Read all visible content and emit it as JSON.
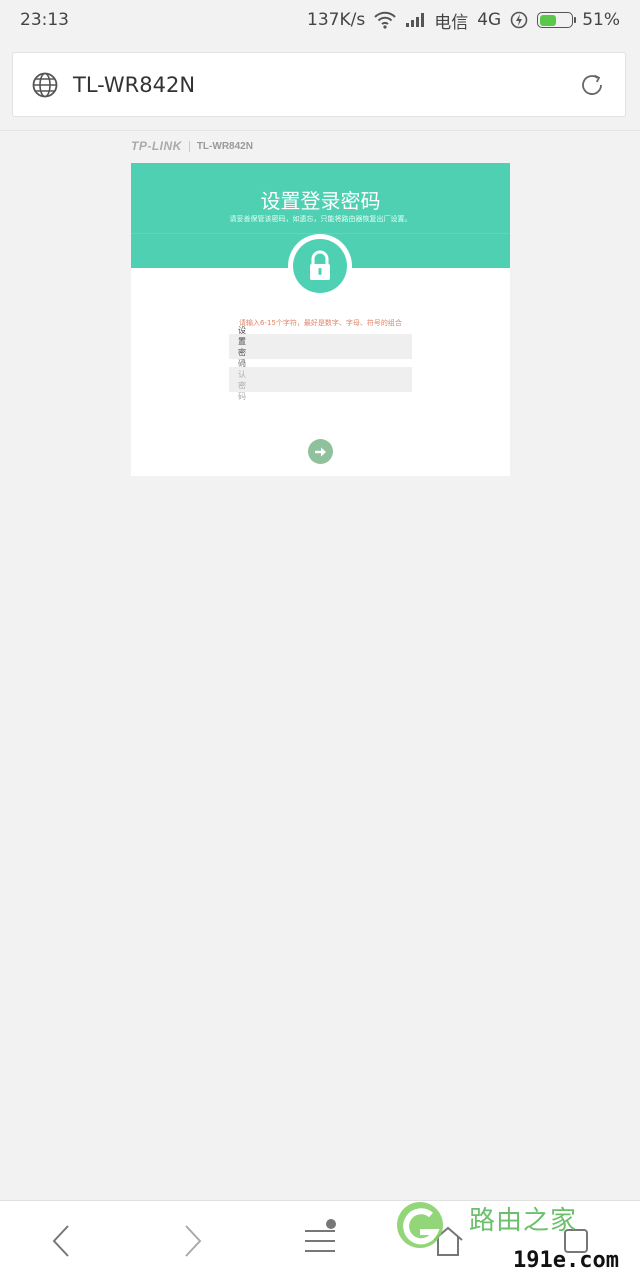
{
  "status_bar": {
    "time": "23:13",
    "speed": "137K/s",
    "carrier": "电信",
    "network": "4G",
    "battery_percent": "51%",
    "battery_level": 0.51
  },
  "browser": {
    "url_title": "TL-WR842N"
  },
  "router_page": {
    "brand_logo": "TP-LINK",
    "model": "TL-WR842N",
    "title": "设置登录密码",
    "subtitle": "请妥善保管该密码，如遗忘，只能将路由器恢复出厂设置。",
    "hint": "请输入6-15个字符，最好是数字、字母、符号的组合",
    "password_label": "设置密码",
    "confirm_label": "确认密码",
    "password_value": "",
    "confirm_value": "",
    "accent_color": "#4fd0b2",
    "hint_color": "#e0836a"
  },
  "watermark": {
    "line1": "路由之家",
    "line2": "191e.com"
  }
}
